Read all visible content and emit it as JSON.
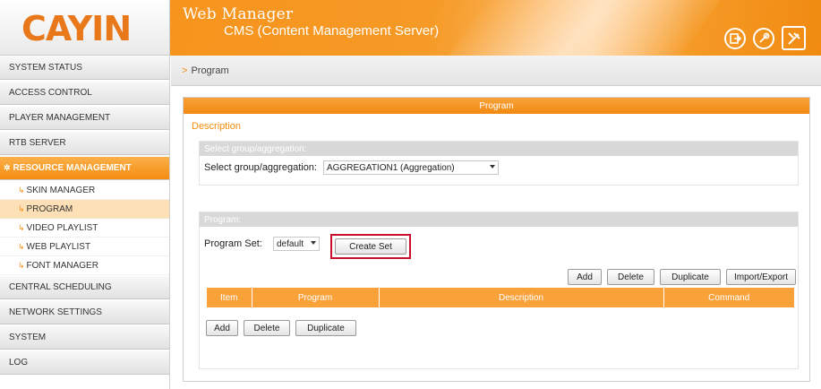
{
  "logo": {
    "text": "CAYIN",
    "color": "#e8781a"
  },
  "header": {
    "app_title": "Web Manager",
    "app_subtitle": "CMS (Content Management Server)",
    "icons": [
      "logout-icon",
      "link-icon",
      "tools-icon"
    ],
    "accent": "#f7941d"
  },
  "sidebar": {
    "items": [
      {
        "label": "SYSTEM STATUS"
      },
      {
        "label": "ACCESS CONTROL"
      },
      {
        "label": "PLAYER MANAGEMENT"
      },
      {
        "label": "RTB SERVER"
      },
      {
        "label": "RESOURCE MANAGEMENT",
        "active": true
      },
      {
        "label": "CENTRAL SCHEDULING"
      },
      {
        "label": "NETWORK SETTINGS"
      },
      {
        "label": "SYSTEM"
      },
      {
        "label": "LOG"
      }
    ],
    "sub_items": [
      {
        "label": "SKIN MANAGER"
      },
      {
        "label": "PROGRAM",
        "active": true
      },
      {
        "label": "VIDEO PLAYLIST"
      },
      {
        "label": "WEB PLAYLIST"
      },
      {
        "label": "FONT MANAGER"
      }
    ]
  },
  "breadcrumb": {
    "separator": ">",
    "current": "Program"
  },
  "panel": {
    "title": "Program",
    "description_link": "Description",
    "group_section": {
      "heading": "Select group/aggregation:",
      "label": "Select group/aggregation:",
      "selected": "AGGREGATION1 (Aggregation)"
    },
    "program_section": {
      "heading": "Program:",
      "set_label": "Program Set:",
      "set_selected": "default",
      "create_set_button": "Create Set",
      "toolbar_buttons": [
        "Add",
        "Delete",
        "Duplicate",
        "Import/Export"
      ],
      "table_columns": [
        "Item",
        "Program",
        "Description",
        "Command"
      ],
      "bottom_buttons": [
        "Add",
        "Delete",
        "Duplicate"
      ]
    }
  }
}
